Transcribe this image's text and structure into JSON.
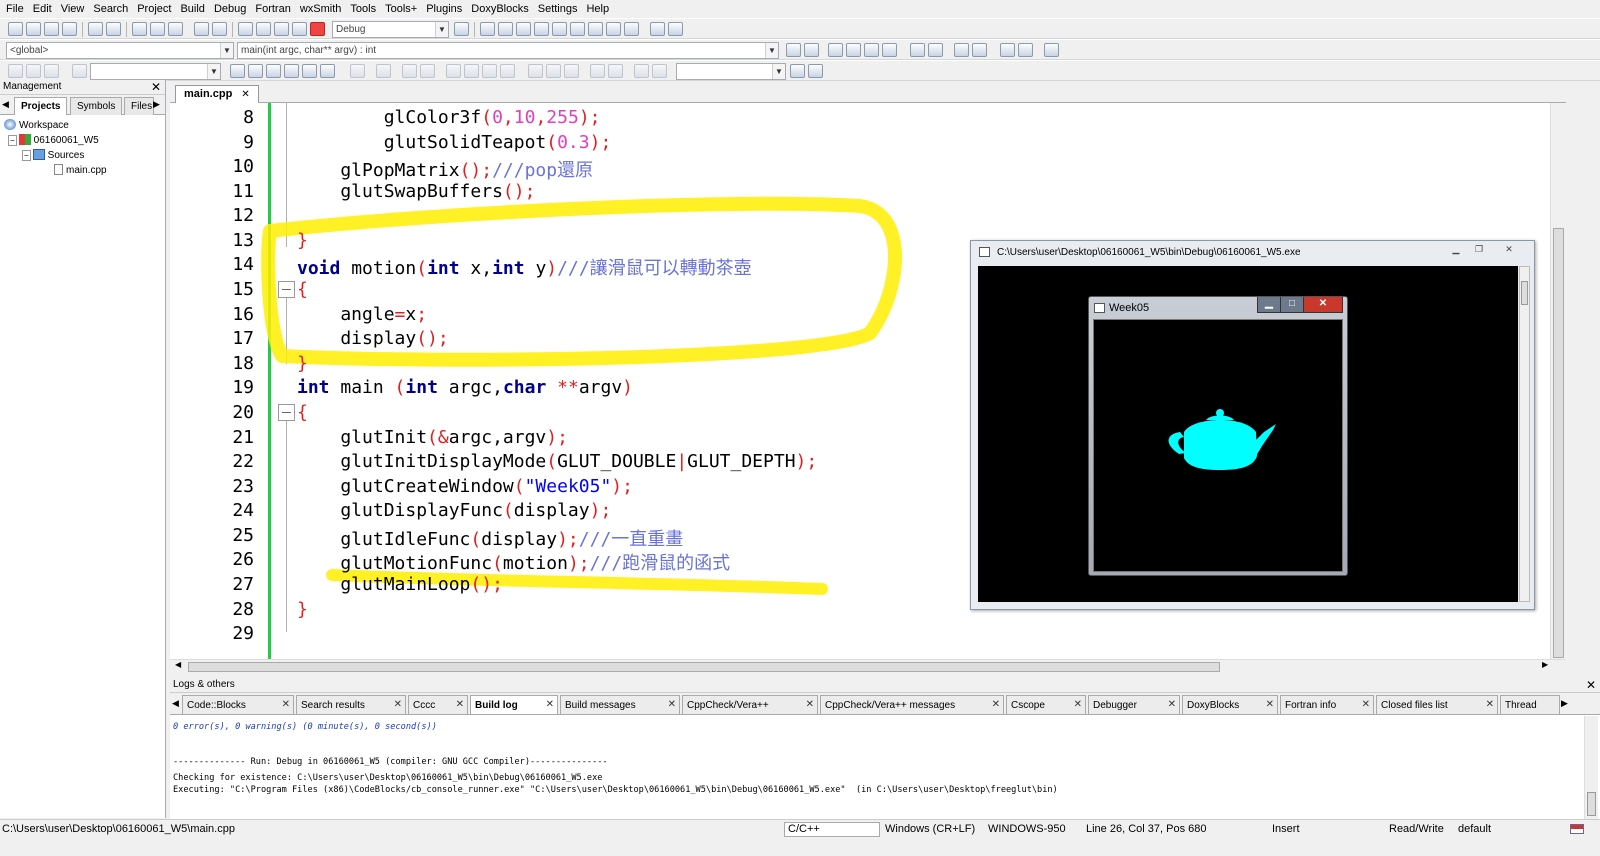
{
  "menu": [
    "File",
    "Edit",
    "View",
    "Search",
    "Project",
    "Build",
    "Debug",
    "Fortran",
    "wxSmith",
    "Tools",
    "Tools+",
    "Plugins",
    "DoxyBlocks",
    "Settings",
    "Help"
  ],
  "toolbar": {
    "build_target": "Debug",
    "scope": "<global>",
    "function": "main(int argc, char** argv) : int",
    "search_value": "",
    "find_value": ""
  },
  "management": {
    "title": "Management",
    "tabs": [
      "Projects",
      "Symbols",
      "Files"
    ],
    "tree": {
      "workspace": "Workspace",
      "project": "06160061_W5",
      "folder": "Sources",
      "file": "main.cpp"
    }
  },
  "editor": {
    "tab": "main.cpp",
    "lines": [
      {
        "n": "8"
      },
      {
        "n": "9"
      },
      {
        "n": "10"
      },
      {
        "n": "11"
      },
      {
        "n": "12"
      },
      {
        "n": "13"
      },
      {
        "n": "14"
      },
      {
        "n": "15"
      },
      {
        "n": "16"
      },
      {
        "n": "17"
      },
      {
        "n": "18"
      },
      {
        "n": "19"
      },
      {
        "n": "20"
      },
      {
        "n": "21"
      },
      {
        "n": "22"
      },
      {
        "n": "23"
      },
      {
        "n": "24"
      },
      {
        "n": "25"
      },
      {
        "n": "26"
      },
      {
        "n": "27"
      },
      {
        "n": "28"
      },
      {
        "n": "29"
      }
    ],
    "code": {
      "l8a": "        glColor3f",
      "l8b": "(",
      "l8c": "0",
      "l8d": ",",
      "l8e": "10",
      "l8f": ",",
      "l8g": "255",
      "l8h": ");",
      "l9a": "        glutSolidTeapot",
      "l9b": "(",
      "l9c": "0.3",
      "l9d": ");",
      "l10a": "    glPopMatrix",
      "l10b": "();",
      "l10c": "///pop還原",
      "l11a": "    glutSwapBuffers",
      "l11b": "();",
      "l13a": "}",
      "l14a": "void",
      "l14b": " motion",
      "l14c": "(",
      "l14d": "int",
      "l14e": " x,",
      "l14f": "int",
      "l14g": " y",
      "l14h": ")",
      "l14i": "///讓滑鼠可以轉動茶壺",
      "l15a": "{",
      "l16a": "    angle",
      "l16b": "=",
      "l16c": "x",
      "l16d": ";",
      "l17a": "    display",
      "l17b": "();",
      "l18a": "}",
      "l19a": "int",
      "l19b": " main ",
      "l19c": "(",
      "l19d": "int",
      "l19e": " argc,",
      "l19f": "char",
      "l19g": " **",
      "l19h": "argv",
      "l19i": ")",
      "l20a": "{",
      "l21a": "    glutInit",
      "l21b": "(&",
      "l21c": "argc,argv",
      "l21d": ");",
      "l22a": "    glutInitDisplayMode",
      "l22b": "(",
      "l22c": "GLUT_DOUBLE",
      "l22d": "|",
      "l22e": "GLUT_DEPTH",
      "l22f": ");",
      "l23a": "    glutCreateWindow",
      "l23b": "(",
      "l23c": "\"Week05\"",
      "l23d": ");",
      "l24a": "    glutDisplayFunc",
      "l24b": "(",
      "l24c": "display",
      "l24d": ");",
      "l25a": "    glutIdleFunc",
      "l25b": "(",
      "l25c": "display",
      "l25d": ");",
      "l25e": "///一直重畫",
      "l26a": "    glutMotionFunc",
      "l26b": "(",
      "l26c": "motion",
      "l26d": ");",
      "l26e": "///跑滑鼠的函式",
      "l27a": "    glutMainLoop",
      "l27b": "();",
      "l28a": "}"
    }
  },
  "console_window": {
    "title": "C:\\Users\\user\\Desktop\\06160061_W5\\bin\\Debug\\06160061_W5.exe"
  },
  "glut_window": {
    "title": "Week05",
    "teapot_color": "#00ffff"
  },
  "logs": {
    "title": "Logs & others",
    "tabs": [
      "Code::Blocks",
      "Search results",
      "Cccc",
      "Build log",
      "Build messages",
      "CppCheck/Vera++",
      "CppCheck/Vera++ messages",
      "Cscope",
      "Debugger",
      "DoxyBlocks",
      "Fortran info",
      "Closed files list",
      "Thread"
    ],
    "active_tab": "Build log",
    "lines": [
      "0 error(s), 0 warning(s) (0 minute(s), 0 second(s))",
      "-------------- Run: Debug in 06160061_W5 (compiler: GNU GCC Compiler)---------------",
      "Checking for existence: C:\\Users\\user\\Desktop\\06160061_W5\\bin\\Debug\\06160061_W5.exe",
      "Executing: \"C:\\Program Files (x86)\\CodeBlocks/cb_console_runner.exe\" \"C:\\Users\\user\\Desktop\\06160061_W5\\bin\\Debug\\06160061_W5.exe\"  (in C:\\Users\\user\\Desktop\\freeglut\\bin)"
    ]
  },
  "status": {
    "path": "C:\\Users\\user\\Desktop\\06160061_W5\\main.cpp",
    "language": "C/C++",
    "eol": "Windows (CR+LF)",
    "encoding": "WINDOWS-950",
    "position": "Line 26, Col 37, Pos 680",
    "mode": "Insert",
    "access": "Read/Write",
    "profile": "default"
  },
  "colors": {
    "keyword": "#00008b",
    "punct": "#e02020",
    "number": "#e040c0",
    "string": "#0000ff",
    "comment": "#6a73d8",
    "highlight": "#ffef00",
    "changebar": "#22cc44"
  }
}
